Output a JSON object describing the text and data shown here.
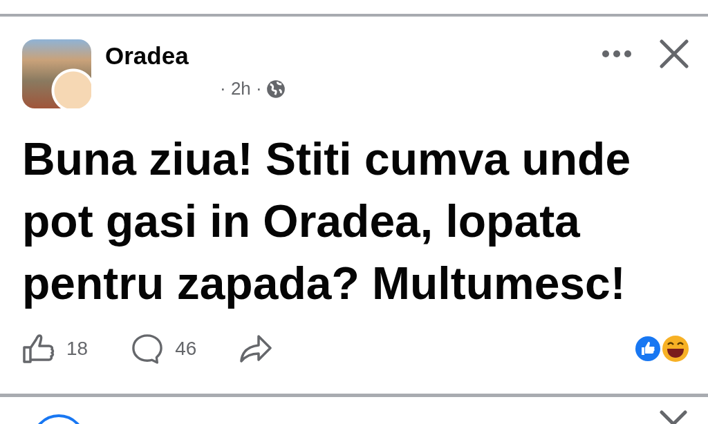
{
  "post": {
    "author": "Oradea",
    "time": "· 2h ·",
    "text": "Buna ziua! Stiti cumva unde pot gasi in Oradea, lopata pentru zapada? Multumesc!",
    "likes": "18",
    "comments": "46"
  }
}
